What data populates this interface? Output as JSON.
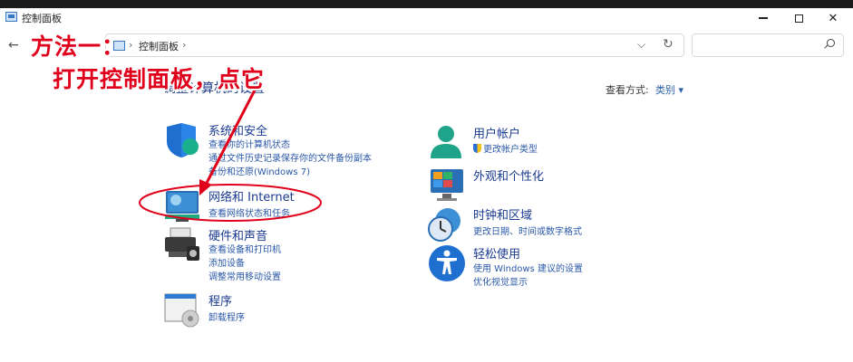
{
  "window": {
    "title": "控制面板"
  },
  "address": {
    "crumb": "控制面板",
    "separator": "›"
  },
  "search": {
    "placeholder": ""
  },
  "heading": "调整计算机的设置",
  "view_by": {
    "label": "查看方式:",
    "value": "类别 ▾"
  },
  "annotation": {
    "line1": "方法一：",
    "line2": "打开控制面板，点它"
  },
  "left_categories": [
    {
      "title": "系统和安全",
      "links": [
        "查看你的计算机状态",
        "通过文件历史记录保存你的文件备份副本",
        "备份和还原(Windows 7)"
      ]
    },
    {
      "title": "网络和 Internet",
      "links": [
        "查看网络状态和任务"
      ]
    },
    {
      "title": "硬件和声音",
      "links": [
        "查看设备和打印机",
        "添加设备",
        "调整常用移动设置"
      ]
    },
    {
      "title": "程序",
      "links": [
        "卸载程序"
      ]
    }
  ],
  "right_categories": [
    {
      "title": "用户帐户",
      "links": [
        "更改帐户类型"
      ]
    },
    {
      "title": "外观和个性化",
      "links": []
    },
    {
      "title": "时钟和区域",
      "links": [
        "更改日期、时间或数字格式"
      ]
    },
    {
      "title": "轻松使用",
      "links": [
        "使用 Windows 建议的设置",
        "优化视觉显示"
      ]
    }
  ],
  "colors": {
    "annotation_red": "#e0001b",
    "link_blue": "#2a58a8",
    "title_blue": "#1a3a8f"
  }
}
